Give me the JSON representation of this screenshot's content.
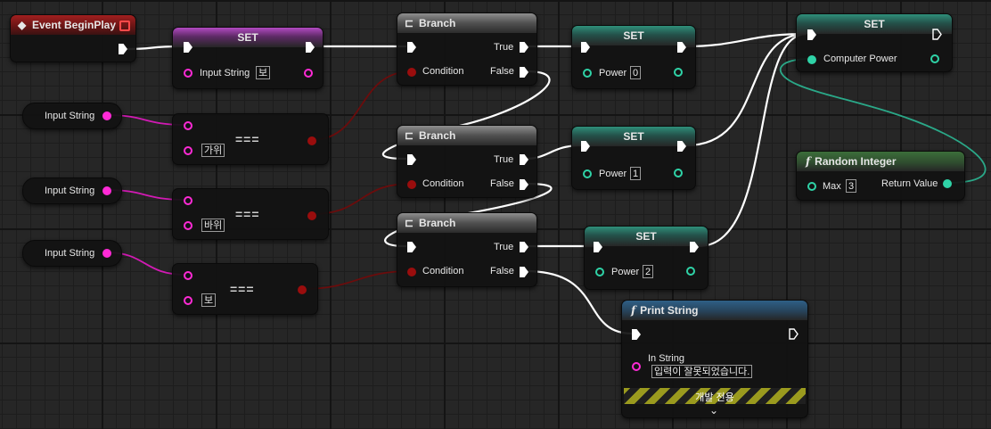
{
  "event": {
    "title": "Event BeginPlay"
  },
  "set1": {
    "title": "SET",
    "var_label": "Input String",
    "var_value": "보"
  },
  "getters": [
    {
      "label": "Input String"
    },
    {
      "label": "Input String"
    },
    {
      "label": "Input String"
    }
  ],
  "compares": [
    {
      "value": "가위",
      "op": "==="
    },
    {
      "value": "바위",
      "op": "==="
    },
    {
      "value": "보",
      "op": "==="
    }
  ],
  "branches": [
    {
      "title": "Branch",
      "true_label": "True",
      "false_label": "False",
      "condition_label": "Condition"
    },
    {
      "title": "Branch",
      "true_label": "True",
      "false_label": "False",
      "condition_label": "Condition"
    },
    {
      "title": "Branch",
      "true_label": "True",
      "false_label": "False",
      "condition_label": "Condition"
    }
  ],
  "power_sets": [
    {
      "title": "SET",
      "label": "Power",
      "value": "0"
    },
    {
      "title": "SET",
      "label": "Power",
      "value": "1"
    },
    {
      "title": "SET",
      "label": "Power",
      "value": "2"
    }
  ],
  "final_set": {
    "title": "SET",
    "label": "Computer Power"
  },
  "random": {
    "icon": "f",
    "title": "Random Integer",
    "max_label": "Max",
    "max_value": "3",
    "return_label": "Return Value"
  },
  "print": {
    "icon": "f",
    "title": "Print String",
    "in_label": "In String",
    "in_value": "입력이 잘못되었습니다.",
    "dev_only": "개발 전용",
    "expand_glyph": "⌄"
  },
  "colors": {
    "string_pin": "#ff2ad6",
    "int_pin": "#2fd3a7",
    "bool_pin": "#9a0d0d",
    "exec": "#ffffff"
  }
}
